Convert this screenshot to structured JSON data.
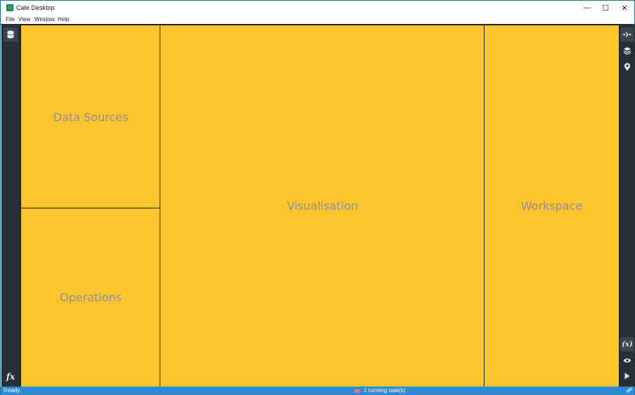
{
  "window": {
    "title": "Cate Desktop",
    "controls": {
      "minimize": "—",
      "maximize": "☐",
      "close": "✕"
    }
  },
  "menu": [
    "File",
    "View",
    "Window",
    "Help"
  ],
  "panels": {
    "data_sources": "Data Sources",
    "operations": "Operations",
    "visualisation": "Visualisation",
    "workspace": "Workspace"
  },
  "left_sidebar": {
    "bottom_label": "fx"
  },
  "right_sidebar": {
    "variables_label": "(x)"
  },
  "status": {
    "text": "Ready.",
    "tasks": "1 running task(s)"
  },
  "colors": {
    "panel_bg": "#fec42c",
    "sidebar_bg": "#253136",
    "statusbar_bg": "#2d8ad4",
    "panel_label": "#8b8fa6"
  },
  "icons": {
    "app": "app-icon",
    "data-sources": "database-icon",
    "operations": "function-icon",
    "panel-toggle": "panel-toggle-icon",
    "layers": "layers-icon",
    "places": "map-marker-icon",
    "variables": "variables-icon",
    "view": "eye-icon",
    "run": "play-icon",
    "status": "link-icon"
  }
}
